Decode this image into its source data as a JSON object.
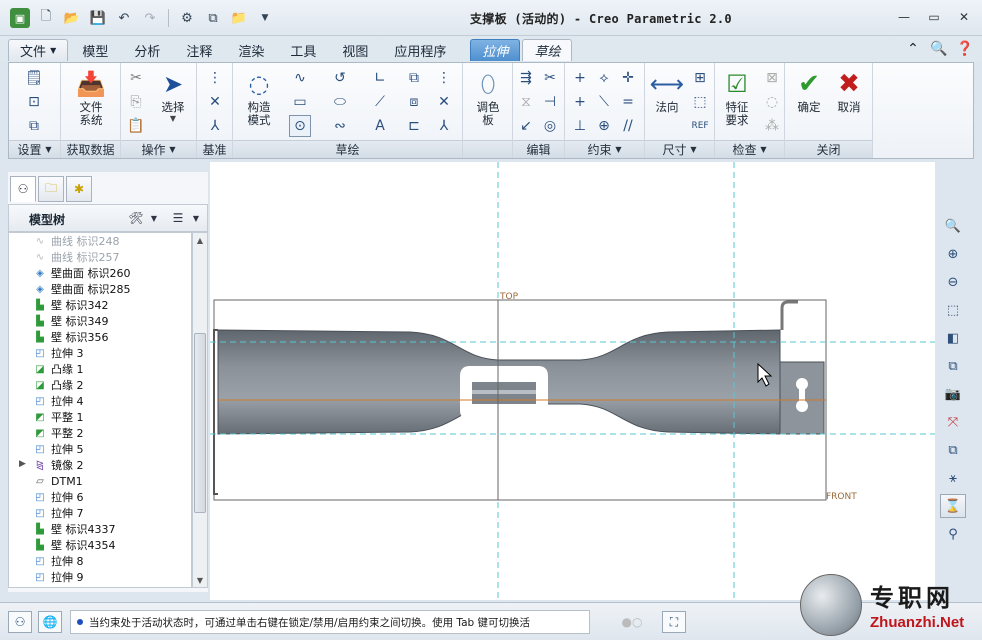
{
  "window": {
    "title": "支撑板 (活动的) - Creo Parametric 2.0"
  },
  "tabs": [
    "文件",
    "模型",
    "分析",
    "注释",
    "渲染",
    "工具",
    "视图",
    "应用程序"
  ],
  "context_tabs": {
    "extrude": "拉伸",
    "sketch": "草绘"
  },
  "ribbon": {
    "groups": {
      "setup": "设置",
      "get_data": "获取数据",
      "operations": "操作",
      "datum": "基准",
      "sketching": "草绘",
      "editing": "编辑",
      "constrain": "约束",
      "dimension": "尺寸",
      "inspect": "检查",
      "close": "关闭"
    },
    "buttons": {
      "file_system": "文件\n系统",
      "select": "选择",
      "construction_mode": "构造\n模式",
      "palette": "调色\n板",
      "normal": "法向",
      "feature_requirements": "特征\n要求",
      "ok": "确定",
      "cancel": "取消"
    }
  },
  "model_tree": {
    "title": "模型树",
    "items": [
      {
        "label": "曲线 标识248",
        "icon": "curve-icon",
        "faded": true
      },
      {
        "label": "曲线 标识257",
        "icon": "curve-icon",
        "faded": true
      },
      {
        "label": "壁曲面 标识260",
        "icon": "wall-surface-icon"
      },
      {
        "label": "壁曲面 标识285",
        "icon": "wall-surface-icon"
      },
      {
        "label": "壁 标识342",
        "icon": "wall-icon"
      },
      {
        "label": "壁 标识349",
        "icon": "wall-icon"
      },
      {
        "label": "壁 标识356",
        "icon": "wall-icon"
      },
      {
        "label": "拉伸 3",
        "icon": "extrude-icon"
      },
      {
        "label": "凸缘 1",
        "icon": "flange-icon"
      },
      {
        "label": "凸缘 2",
        "icon": "flange-icon"
      },
      {
        "label": "拉伸 4",
        "icon": "extrude-icon"
      },
      {
        "label": "平整 1",
        "icon": "flatten-icon"
      },
      {
        "label": "平整 2",
        "icon": "flatten-icon"
      },
      {
        "label": "拉伸 5",
        "icon": "extrude-icon"
      },
      {
        "label": "镜像 2",
        "icon": "mirror-icon",
        "expandable": true
      },
      {
        "label": "DTM1",
        "icon": "datum-plane-icon"
      },
      {
        "label": "拉伸 6",
        "icon": "extrude-icon"
      },
      {
        "label": "拉伸 7",
        "icon": "extrude-icon"
      },
      {
        "label": "壁 标识4337",
        "icon": "wall-icon"
      },
      {
        "label": "壁 标识4354",
        "icon": "wall-icon"
      },
      {
        "label": "拉伸 8",
        "icon": "extrude-icon"
      },
      {
        "label": "拉伸 9",
        "icon": "extrude-icon"
      }
    ]
  },
  "graphics": {
    "datum_top": "TOP",
    "datum_front": "FRONT"
  },
  "status": {
    "message": "当约束处于活动状态时，可通过单击右键在锁定/禁用/启用约束之间切换。使用 Tab 键可切换活"
  },
  "watermark": {
    "cn": "专职网",
    "en": "Zhuanzhi.Net"
  },
  "colors": {
    "part": "#7c838b",
    "datum": "#55c8d0",
    "accent": "#4e8fcf"
  }
}
